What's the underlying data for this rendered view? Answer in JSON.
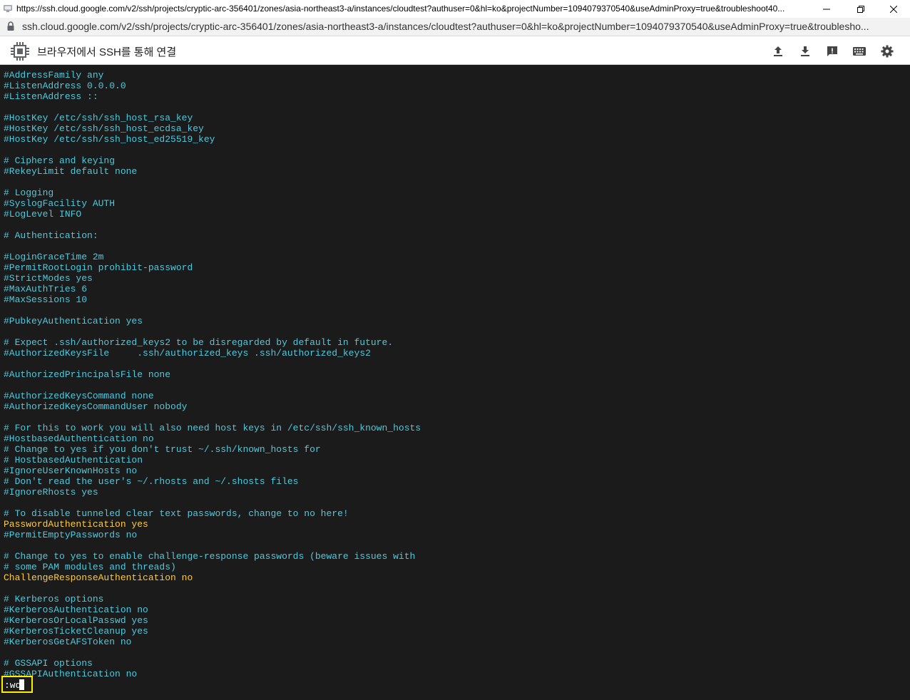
{
  "window": {
    "title": "https://ssh.cloud.google.com/v2/ssh/projects/cryptic-arc-356401/zones/asia-northeast3-a/instances/cloudtest?authuser=0&hl=ko&projectNumber=1094079370540&useAdminProxy=true&troubleshoot40...",
    "controls": [
      "minimize-icon",
      "restore-icon",
      "close-icon"
    ]
  },
  "address": {
    "url": "ssh.cloud.google.com/v2/ssh/projects/cryptic-arc-356401/zones/asia-northeast3-a/instances/cloudtest?authuser=0&hl=ko&projectNumber=1094079370540&useAdminProxy=true&troublesho..."
  },
  "header": {
    "title": "브라우저에서 SSH를 통해 연결",
    "icons": [
      "upload-icon",
      "download-icon",
      "feedback-icon",
      "keyboard-icon",
      "gear-icon"
    ]
  },
  "terminal": {
    "colors": {
      "background": "#1b1b1b",
      "text": "#4fc9dd",
      "highlight": "#ffcb3a",
      "command_box": "#ffee00"
    },
    "lines": [
      "#AddressFamily any",
      "#ListenAddress 0.0.0.0",
      "#ListenAddress ::",
      "",
      "#HostKey /etc/ssh/ssh_host_rsa_key",
      "#HostKey /etc/ssh/ssh_host_ecdsa_key",
      "#HostKey /etc/ssh/ssh_host_ed25519_key",
      "",
      "# Ciphers and keying",
      "#RekeyLimit default none",
      "",
      "# Logging",
      "#SyslogFacility AUTH",
      "#LogLevel INFO",
      "",
      "# Authentication:",
      "",
      "#LoginGraceTime 2m",
      "#PermitRootLogin prohibit-password",
      "#StrictModes yes",
      "#MaxAuthTries 6",
      "#MaxSessions 10",
      "",
      "#PubkeyAuthentication yes",
      "",
      "# Expect .ssh/authorized_keys2 to be disregarded by default in future.",
      "#AuthorizedKeysFile     .ssh/authorized_keys .ssh/authorized_keys2",
      "",
      "#AuthorizedPrincipalsFile none",
      "",
      "#AuthorizedKeysCommand none",
      "#AuthorizedKeysCommandUser nobody",
      "",
      "# For this to work you will also need host keys in /etc/ssh/ssh_known_hosts",
      "#HostbasedAuthentication no",
      "# Change to yes if you don't trust ~/.ssh/known_hosts for",
      "# HostbasedAuthentication",
      "#IgnoreUserKnownHosts no",
      "# Don't read the user's ~/.rhosts and ~/.shosts files",
      "#IgnoreRhosts yes",
      "",
      "# To disable tunneled clear text passwords, change to no here!",
      "PasswordAuthentication yes",
      "#PermitEmptyPasswords no",
      "",
      "# Change to yes to enable challenge-response passwords (beware issues with",
      "# some PAM modules and threads)",
      "ChallengeResponseAuthentication no",
      "",
      "# Kerberos options",
      "#KerberosAuthentication no",
      "#KerberosOrLocalPasswd yes",
      "#KerberosTicketCleanup yes",
      "#KerberosGetAFSToken no",
      "",
      "# GSSAPI options",
      "#GSSAPIAuthentication no"
    ],
    "highlighted_lines": [
      42,
      47
    ],
    "command": ":wq"
  }
}
